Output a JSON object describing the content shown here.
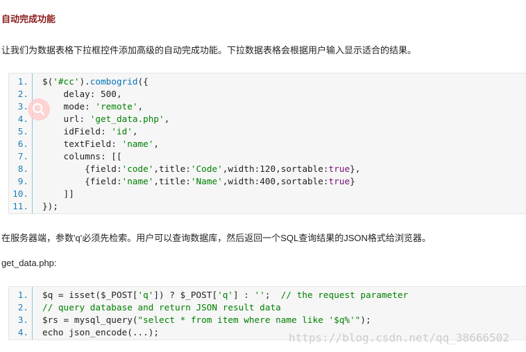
{
  "heading": "自动完成功能",
  "intro": "让我们为数据表格下拉框控件添加高级的自动完成功能。下拉数据表格会根据用户输入显示适合的结果。",
  "server_note": "在服务器端，参数'q'必须先检索。用户可以查询数据库，然后返回一个SQL查询结果的JSON格式给浏览器。",
  "file_label": "get_data.php:",
  "code1": [
    {
      "n": "1.",
      "parts": [
        [
          "",
          "$("
        ],
        [
          "str",
          "'#cc'"
        ],
        [
          "",
          ")."
        ],
        [
          "fn",
          "combogrid"
        ],
        [
          "",
          "({"
        ]
      ]
    },
    {
      "n": "2.",
      "parts": [
        [
          "",
          "    delay: 500,"
        ]
      ]
    },
    {
      "n": "3.",
      "parts": [
        [
          "",
          "    mode: "
        ],
        [
          "str",
          "'remote'"
        ],
        [
          "",
          ","
        ]
      ]
    },
    {
      "n": "4.",
      "parts": [
        [
          "",
          "    url: "
        ],
        [
          "str",
          "'get_data.php'"
        ],
        [
          "",
          ","
        ]
      ]
    },
    {
      "n": "5.",
      "parts": [
        [
          "",
          "    idField: "
        ],
        [
          "str",
          "'id'"
        ],
        [
          "",
          ","
        ]
      ]
    },
    {
      "n": "6.",
      "parts": [
        [
          "",
          "    textField: "
        ],
        [
          "str",
          "'name'"
        ],
        [
          "",
          ","
        ]
      ]
    },
    {
      "n": "7.",
      "parts": [
        [
          "",
          "    columns: [["
        ]
      ]
    },
    {
      "n": "8.",
      "parts": [
        [
          "",
          "        {field:"
        ],
        [
          "str",
          "'code'"
        ],
        [
          "",
          ",title:"
        ],
        [
          "str",
          "'Code'"
        ],
        [
          "",
          ",width:120,sortable:"
        ],
        [
          "kw",
          "true"
        ],
        [
          "",
          "},"
        ]
      ]
    },
    {
      "n": "9.",
      "parts": [
        [
          "",
          "        {field:"
        ],
        [
          "str",
          "'name'"
        ],
        [
          "",
          ",title:"
        ],
        [
          "str",
          "'Name'"
        ],
        [
          "",
          ",width:400,sortable:"
        ],
        [
          "kw",
          "true"
        ],
        [
          "",
          "}"
        ]
      ]
    },
    {
      "n": "10.",
      "parts": [
        [
          "",
          "    ]]"
        ]
      ]
    },
    {
      "n": "11.",
      "parts": [
        [
          "",
          "});"
        ]
      ]
    }
  ],
  "code2": [
    {
      "n": "1.",
      "parts": [
        [
          "",
          "$q = isset($_POST["
        ],
        [
          "str",
          "'q'"
        ],
        [
          "",
          "]) ? $_POST["
        ],
        [
          "str",
          "'q'"
        ],
        [
          "",
          "] : "
        ],
        [
          "str",
          "''"
        ],
        [
          "",
          ";  "
        ],
        [
          "cm",
          "// the request parameter"
        ]
      ]
    },
    {
      "n": "2.",
      "parts": [
        [
          "cm",
          "// query database and return JSON result data"
        ]
      ]
    },
    {
      "n": "3.",
      "parts": [
        [
          "",
          "$rs = mysql_query("
        ],
        [
          "str",
          "\"select * from item where name like '$q%'\""
        ],
        [
          "",
          ");"
        ]
      ]
    },
    {
      "n": "4.",
      "parts": [
        [
          "",
          "echo json_encode(...);"
        ]
      ]
    }
  ],
  "watermark": "https://blog.csdn.net/qq_38666502",
  "icons": {
    "zoom": "magnifier-icon"
  }
}
